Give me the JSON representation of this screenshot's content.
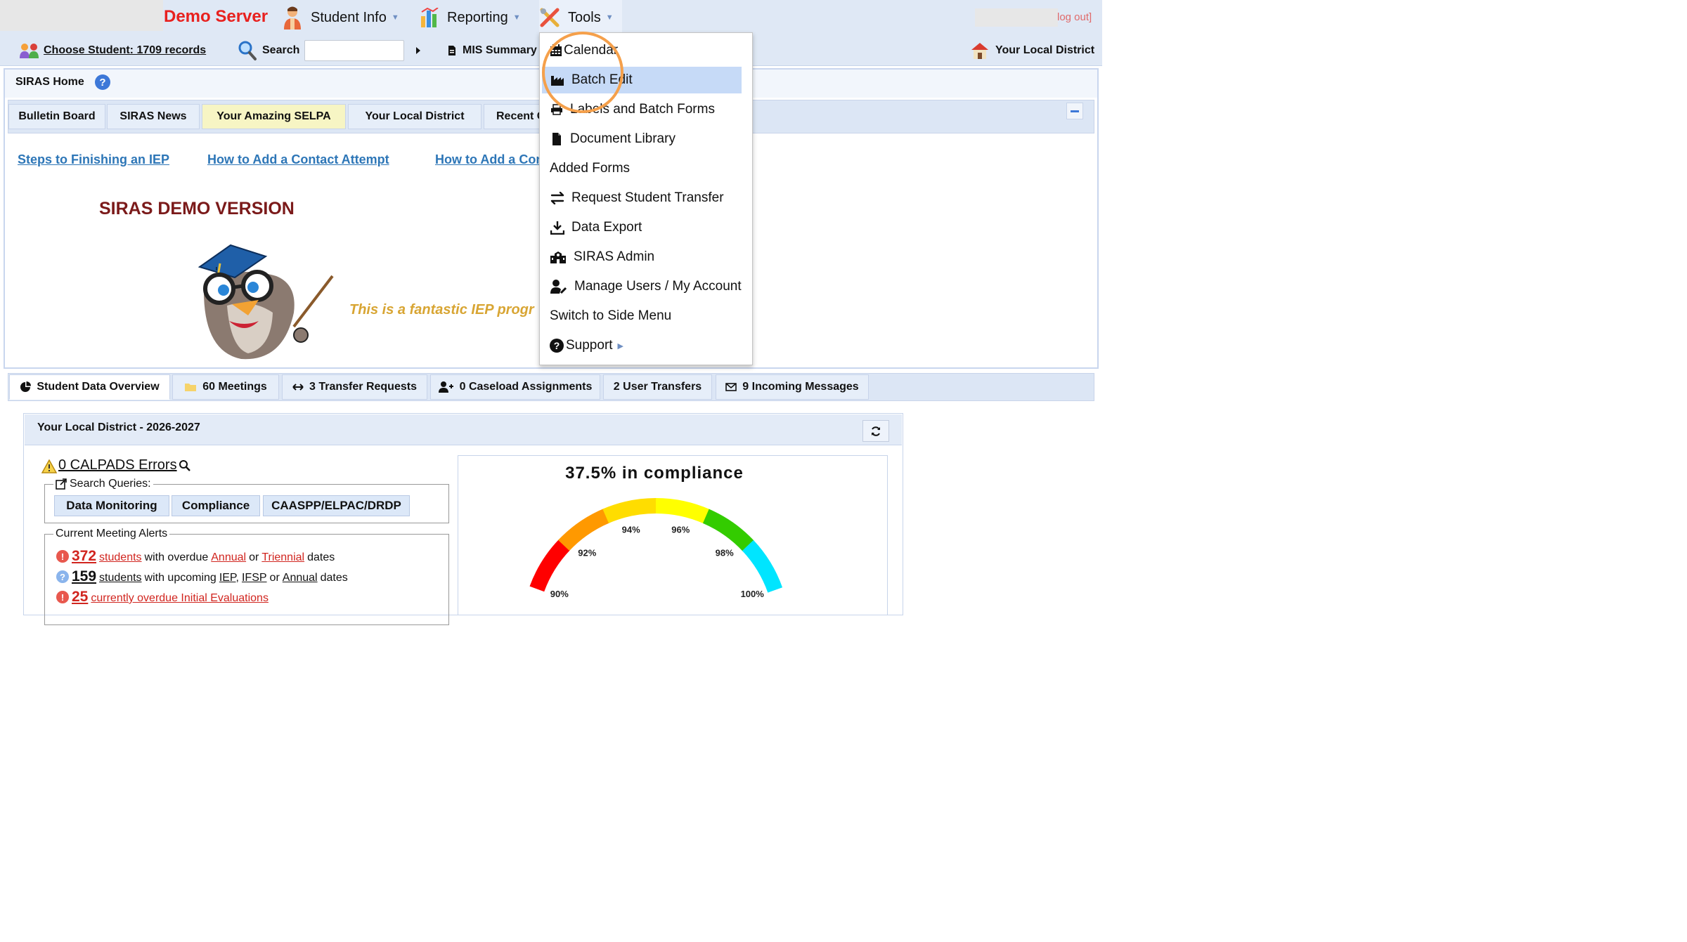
{
  "topbar": {
    "brand": "Demo Server",
    "nav": [
      {
        "label": "Student Info"
      },
      {
        "label": "Reporting"
      },
      {
        "label": "Tools"
      }
    ],
    "logout": "log out]"
  },
  "secondbar": {
    "choose_student": "Choose Student: 1709 records",
    "search_label": "Search",
    "search_value": "",
    "mis_summary": "MIS Summary",
    "district": "Your Local District"
  },
  "home": {
    "title": "SIRAS Home",
    "help": "?",
    "tabs": [
      {
        "label": "Bulletin Board"
      },
      {
        "label": "SIRAS News"
      },
      {
        "label": "Your Amazing SELPA"
      },
      {
        "label": "Your Local District"
      },
      {
        "label": "Recent C"
      }
    ],
    "links": [
      "Steps to Finishing an IEP",
      "How to Add a Contact Attempt",
      "How to Add a Con"
    ],
    "demo_title": "SIRAS DEMO VERSION",
    "tagline": "This is a fantastic IEP progr"
  },
  "bottom_tabs": [
    {
      "label": "Student Data Overview"
    },
    {
      "label": "60 Meetings"
    },
    {
      "label": "3 Transfer Requests"
    },
    {
      "label": "0 Caseload Assignments"
    },
    {
      "label": "2 User Transfers"
    },
    {
      "label": "9 Incoming Messages"
    }
  ],
  "district_panel": {
    "title": "Your Local District - 2026-2027",
    "calpads": "0 CALPADS Errors",
    "search_queries_legend": "Search Queries:",
    "query_buttons": [
      "Data Monitoring",
      "Compliance",
      "CAASPP/ELPAC/DRDP"
    ],
    "alerts_legend": "Current Meeting Alerts",
    "alerts": {
      "overdue_num": "372",
      "overdue_students": "students",
      "overdue_text1": "with overdue",
      "annual": "Annual",
      "or": "or",
      "triennial": "Triennial",
      "dates": "dates",
      "upcoming_num": "159",
      "upcoming_students": "students",
      "upcoming_text1": "with upcoming",
      "iep": "IEP,",
      "ifsp": "IFSP",
      "annual2": "Annual",
      "initial_num": "25",
      "initial_text": "currently overdue Initial Evaluations"
    }
  },
  "gauge": {
    "title": "37.5% in compliance",
    "labels": [
      "90%",
      "92%",
      "94%",
      "96%",
      "98%",
      "100%"
    ],
    "colors": [
      "#ff0000",
      "#ff9900",
      "#ffdd00",
      "#ffff00",
      "#33cc00",
      "#00e5ff"
    ]
  },
  "tools_menu": {
    "items": [
      {
        "label": "Calendar"
      },
      {
        "label": "Batch Edit"
      },
      {
        "label": "Labels and Batch Forms"
      },
      {
        "label": "Document Library"
      },
      {
        "label": "Added Forms"
      },
      {
        "label": "Request Student Transfer"
      },
      {
        "label": "Data Export"
      },
      {
        "label": "SIRAS Admin"
      },
      {
        "label": "Manage Users / My Account"
      },
      {
        "label": "Switch to Side Menu"
      },
      {
        "label": "Support"
      }
    ]
  }
}
